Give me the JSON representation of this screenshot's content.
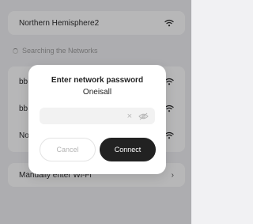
{
  "connected": {
    "name": "Northern Hemisphere2",
    "icon": "wifi-icon"
  },
  "section": {
    "label": "Searching the Networks"
  },
  "networks": [
    {
      "name": "bb",
      "icon": "wifi-icon"
    },
    {
      "name": "bb",
      "icon": "wifi-icon"
    },
    {
      "name": "No",
      "icon": "wifi-icon"
    }
  ],
  "manual": {
    "label": "Manually enter Wi-Fi",
    "icon": "chevron-right-icon"
  },
  "dialog": {
    "title": "Enter network password",
    "ssid": "Oneisall",
    "password_value": "",
    "clear_icon": "clear-icon",
    "visibility_icon": "eye-slash-icon",
    "cancel_label": "Cancel",
    "connect_label": "Connect"
  },
  "colors": {
    "background": "#f1f1f3",
    "primary_button": "#222222",
    "overlay": "rgba(30,30,35,0.32)"
  }
}
